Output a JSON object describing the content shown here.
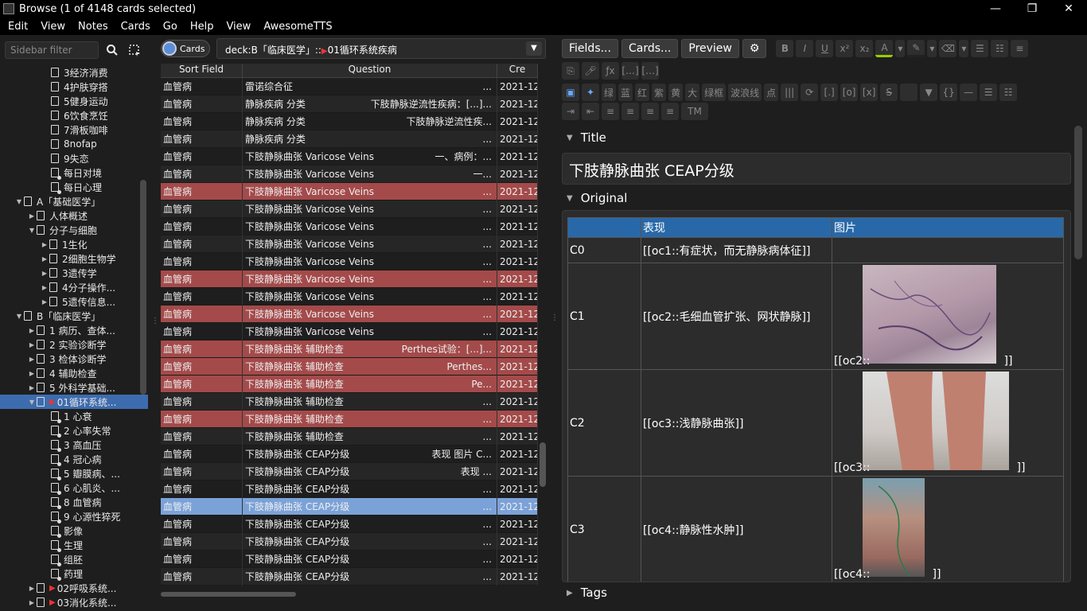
{
  "window": {
    "title": "Browse (1 of 4148 cards selected)",
    "min": "—",
    "max": "❐",
    "close": "✕"
  },
  "menu": [
    "Edit",
    "View",
    "Notes",
    "Cards",
    "Go",
    "Help",
    "View",
    "AwesomeTTS"
  ],
  "sidebar": {
    "filter_placeholder": "Sidebar filter",
    "items": [
      {
        "label": "3经济消费",
        "indent": 64,
        "arrow": "",
        "f": false,
        "flag": false
      },
      {
        "label": "4护肤穿搭",
        "indent": 64,
        "arrow": "",
        "f": false,
        "flag": false
      },
      {
        "label": "5健身运动",
        "indent": 64,
        "arrow": "",
        "f": false,
        "flag": false
      },
      {
        "label": "6饮食烹饪",
        "indent": 64,
        "arrow": "",
        "f": false,
        "flag": false
      },
      {
        "label": "7滑板咖啡",
        "indent": 64,
        "arrow": "",
        "f": false,
        "flag": false
      },
      {
        "label": "8nofap",
        "indent": 64,
        "arrow": "",
        "f": false,
        "flag": false
      },
      {
        "label": "9失恋",
        "indent": 64,
        "arrow": "",
        "f": false,
        "flag": false
      },
      {
        "label": "每日对境",
        "indent": 64,
        "arrow": "",
        "f": true,
        "flag": false
      },
      {
        "label": "每日心理",
        "indent": 64,
        "arrow": "",
        "f": true,
        "flag": false
      },
      {
        "label": "A「基础医学」",
        "indent": 30,
        "arrow": "▼",
        "f": false,
        "flag": false
      },
      {
        "label": "人体概述",
        "indent": 46,
        "arrow": "▶",
        "f": false,
        "flag": false
      },
      {
        "label": "分子与细胞",
        "indent": 46,
        "arrow": "▼",
        "f": false,
        "flag": false
      },
      {
        "label": "1生化",
        "indent": 62,
        "arrow": "▶",
        "f": false,
        "flag": false
      },
      {
        "label": "2细胞生物学",
        "indent": 62,
        "arrow": "▶",
        "f": false,
        "flag": false
      },
      {
        "label": "3遗传学",
        "indent": 62,
        "arrow": "▶",
        "f": false,
        "flag": false
      },
      {
        "label": "4分子操作...",
        "indent": 62,
        "arrow": "▶",
        "f": false,
        "flag": false
      },
      {
        "label": "5遗传信息...",
        "indent": 62,
        "arrow": "▶",
        "f": false,
        "flag": false
      },
      {
        "label": "B「临床医学」",
        "indent": 30,
        "arrow": "▼",
        "f": false,
        "flag": false
      },
      {
        "label": "1 病历、查体...",
        "indent": 46,
        "arrow": "▶",
        "f": false,
        "flag": false
      },
      {
        "label": "2 实验诊断学",
        "indent": 46,
        "arrow": "▶",
        "f": false,
        "flag": false
      },
      {
        "label": "3 检体诊断学",
        "indent": 46,
        "arrow": "▶",
        "f": false,
        "flag": false
      },
      {
        "label": "4 辅助检查",
        "indent": 46,
        "arrow": "▶",
        "f": false,
        "flag": false
      },
      {
        "label": "5 外科学基础...",
        "indent": 46,
        "arrow": "▶",
        "f": false,
        "flag": false
      },
      {
        "label": "01循环系统...",
        "indent": 46,
        "arrow": "▼",
        "f": false,
        "flag": true,
        "sel": true
      },
      {
        "label": "1 心衰",
        "indent": 64,
        "arrow": "",
        "f": true,
        "flag": false
      },
      {
        "label": "2 心率失常",
        "indent": 64,
        "arrow": "",
        "f": true,
        "flag": false
      },
      {
        "label": "3 高血压",
        "indent": 64,
        "arrow": "",
        "f": true,
        "flag": false
      },
      {
        "label": "4 冠心病",
        "indent": 64,
        "arrow": "",
        "f": true,
        "flag": false
      },
      {
        "label": "5 瓣膜病、...",
        "indent": 64,
        "arrow": "",
        "f": true,
        "flag": false
      },
      {
        "label": "6 心肌炎、...",
        "indent": 64,
        "arrow": "",
        "f": true,
        "flag": false
      },
      {
        "label": "8 血管病",
        "indent": 64,
        "arrow": "",
        "f": true,
        "flag": false
      },
      {
        "label": "9 心源性猝死",
        "indent": 64,
        "arrow": "",
        "f": true,
        "flag": false
      },
      {
        "label": "影像",
        "indent": 64,
        "arrow": "",
        "f": true,
        "flag": false
      },
      {
        "label": "生理",
        "indent": 64,
        "arrow": "",
        "f": true,
        "flag": false
      },
      {
        "label": "组胚",
        "indent": 64,
        "arrow": "",
        "f": true,
        "flag": false
      },
      {
        "label": "药理",
        "indent": 64,
        "arrow": "",
        "f": true,
        "flag": false
      },
      {
        "label": "02呼吸系统...",
        "indent": 46,
        "arrow": "▶",
        "f": false,
        "flag": true
      },
      {
        "label": "03消化系统...",
        "indent": 46,
        "arrow": "▶",
        "f": false,
        "flag": true
      }
    ]
  },
  "browser": {
    "toggle_label": "Cards",
    "search_prefix": "deck:B「临床医学」::",
    "search_deck": "01循环系统疾病",
    "columns": [
      "Sort Field",
      "Question",
      "Cre"
    ],
    "rows": [
      {
        "sort": "血管病",
        "q": "雷诺综合征",
        "q2": "...",
        "date": "2021-12",
        "style": "even"
      },
      {
        "sort": "血管病",
        "q": "静脉疾病 分类",
        "q2": "下肢静脉逆流性疾病：[...]...",
        "date": "2021-12",
        "style": "odd"
      },
      {
        "sort": "血管病",
        "q": "静脉疾病 分类",
        "q2": "下肢静脉逆流性疾...",
        "date": "2021-12",
        "style": "even"
      },
      {
        "sort": "血管病",
        "q": "静脉疾病 分类",
        "q2": "...",
        "date": "2021-12",
        "style": "odd"
      },
      {
        "sort": "血管病",
        "q": "下肢静脉曲张 Varicose Veins",
        "q2": "一、病例：...",
        "date": "2021-12",
        "style": "even"
      },
      {
        "sort": "血管病",
        "q": "下肢静脉曲张 Varicose Veins",
        "q2": "一...",
        "date": "2021-12",
        "style": "odd"
      },
      {
        "sort": "血管病",
        "q": "下肢静脉曲张 Varicose Veins",
        "q2": "...",
        "date": "2021-12",
        "style": "red"
      },
      {
        "sort": "血管病",
        "q": "下肢静脉曲张 Varicose Veins",
        "q2": "...",
        "date": "2021-12",
        "style": "odd"
      },
      {
        "sort": "血管病",
        "q": "下肢静脉曲张 Varicose Veins",
        "q2": "...",
        "date": "2021-12",
        "style": "even"
      },
      {
        "sort": "血管病",
        "q": "下肢静脉曲张 Varicose Veins",
        "q2": "...",
        "date": "2021-12",
        "style": "odd"
      },
      {
        "sort": "血管病",
        "q": "下肢静脉曲张 Varicose Veins",
        "q2": "...",
        "date": "2021-12",
        "style": "even"
      },
      {
        "sort": "血管病",
        "q": "下肢静脉曲张 Varicose Veins",
        "q2": "...",
        "date": "2021-12",
        "style": "red"
      },
      {
        "sort": "血管病",
        "q": "下肢静脉曲张 Varicose Veins",
        "q2": "...",
        "date": "2021-12",
        "style": "even"
      },
      {
        "sort": "血管病",
        "q": "下肢静脉曲张 Varicose Veins",
        "q2": "...",
        "date": "2021-12",
        "style": "red"
      },
      {
        "sort": "血管病",
        "q": "下肢静脉曲张 Varicose Veins",
        "q2": "...",
        "date": "2021-12",
        "style": "even"
      },
      {
        "sort": "血管病",
        "q": "下肢静脉曲张 辅助检查",
        "q2": "Perthes试验：[...]...",
        "date": "2021-12",
        "style": "red"
      },
      {
        "sort": "血管病",
        "q": "下肢静脉曲张 辅助检查",
        "q2": "Perthes...",
        "date": "2021-12",
        "style": "red"
      },
      {
        "sort": "血管病",
        "q": "下肢静脉曲张 辅助检查",
        "q2": "Pe...",
        "date": "2021-12",
        "style": "red"
      },
      {
        "sort": "血管病",
        "q": "下肢静脉曲张 辅助检查",
        "q2": "...",
        "date": "2021-12",
        "style": "odd"
      },
      {
        "sort": "血管病",
        "q": "下肢静脉曲张 辅助检查",
        "q2": "...",
        "date": "2021-12",
        "style": "red"
      },
      {
        "sort": "血管病",
        "q": "下肢静脉曲张 辅助检查",
        "q2": "...",
        "date": "2021-12",
        "style": "odd"
      },
      {
        "sort": "血管病",
        "q": "下肢静脉曲张 CEAP分级",
        "q2": "表现 图片 C...",
        "date": "2021-12",
        "style": "even"
      },
      {
        "sort": "血管病",
        "q": "下肢静脉曲张 CEAP分级",
        "q2": "表现 ...",
        "date": "2021-12",
        "style": "odd"
      },
      {
        "sort": "血管病",
        "q": "下肢静脉曲张 CEAP分级",
        "q2": "...",
        "date": "2021-12",
        "style": "even"
      },
      {
        "sort": "血管病",
        "q": "下肢静脉曲张 CEAP分级",
        "q2": "...",
        "date": "2021-12",
        "style": "blue"
      },
      {
        "sort": "血管病",
        "q": "下肢静脉曲张 CEAP分级",
        "q2": "...",
        "date": "2021-12",
        "style": "even"
      },
      {
        "sort": "血管病",
        "q": "下肢静脉曲张 CEAP分级",
        "q2": "...",
        "date": "2021-12",
        "style": "odd"
      },
      {
        "sort": "血管病",
        "q": "下肢静脉曲张 CEAP分级",
        "q2": "...",
        "date": "2021-12",
        "style": "even"
      },
      {
        "sort": "血管病",
        "q": "下肢静脉曲张 CEAP分级",
        "q2": "...",
        "date": "2021-12",
        "style": "odd"
      }
    ]
  },
  "editor": {
    "toolbar": {
      "fields": "Fields...",
      "cards": "Cards...",
      "preview": "Preview"
    },
    "format_row2": [
      "绿",
      "蓝",
      "红",
      "紫",
      "黄",
      "大",
      "绿框",
      "波浪线",
      "点"
    ],
    "tm": "TM",
    "title_label": "Title",
    "title_value": "下肢静脉曲张 CEAP分级",
    "original_label": "Original",
    "tags_label": "Tags",
    "table": {
      "headers": [
        "",
        "表现",
        "图片"
      ],
      "rows": [
        {
          "c": "C0",
          "desc": "[[oc1::有症状，而无静脉病体征]]",
          "img": "",
          "img_suffix": ""
        },
        {
          "c": "C1",
          "desc": "[[oc2::毛细血管扩张、网状静脉]]",
          "img": "[[oc2::",
          "img_suffix": "]]"
        },
        {
          "c": "C2",
          "desc": "[[oc3::浅静脉曲张]]",
          "img": "[[oc3::",
          "img_suffix": "]]"
        },
        {
          "c": "C3",
          "desc": "[[oc4::静脉性水肿]]",
          "img": "[[oc4::",
          "img_suffix": "]]"
        }
      ]
    },
    "colors": {
      "header": "#2868a8",
      "red_row": "#a44a4a",
      "selected_row": "#7ba2d8"
    }
  }
}
